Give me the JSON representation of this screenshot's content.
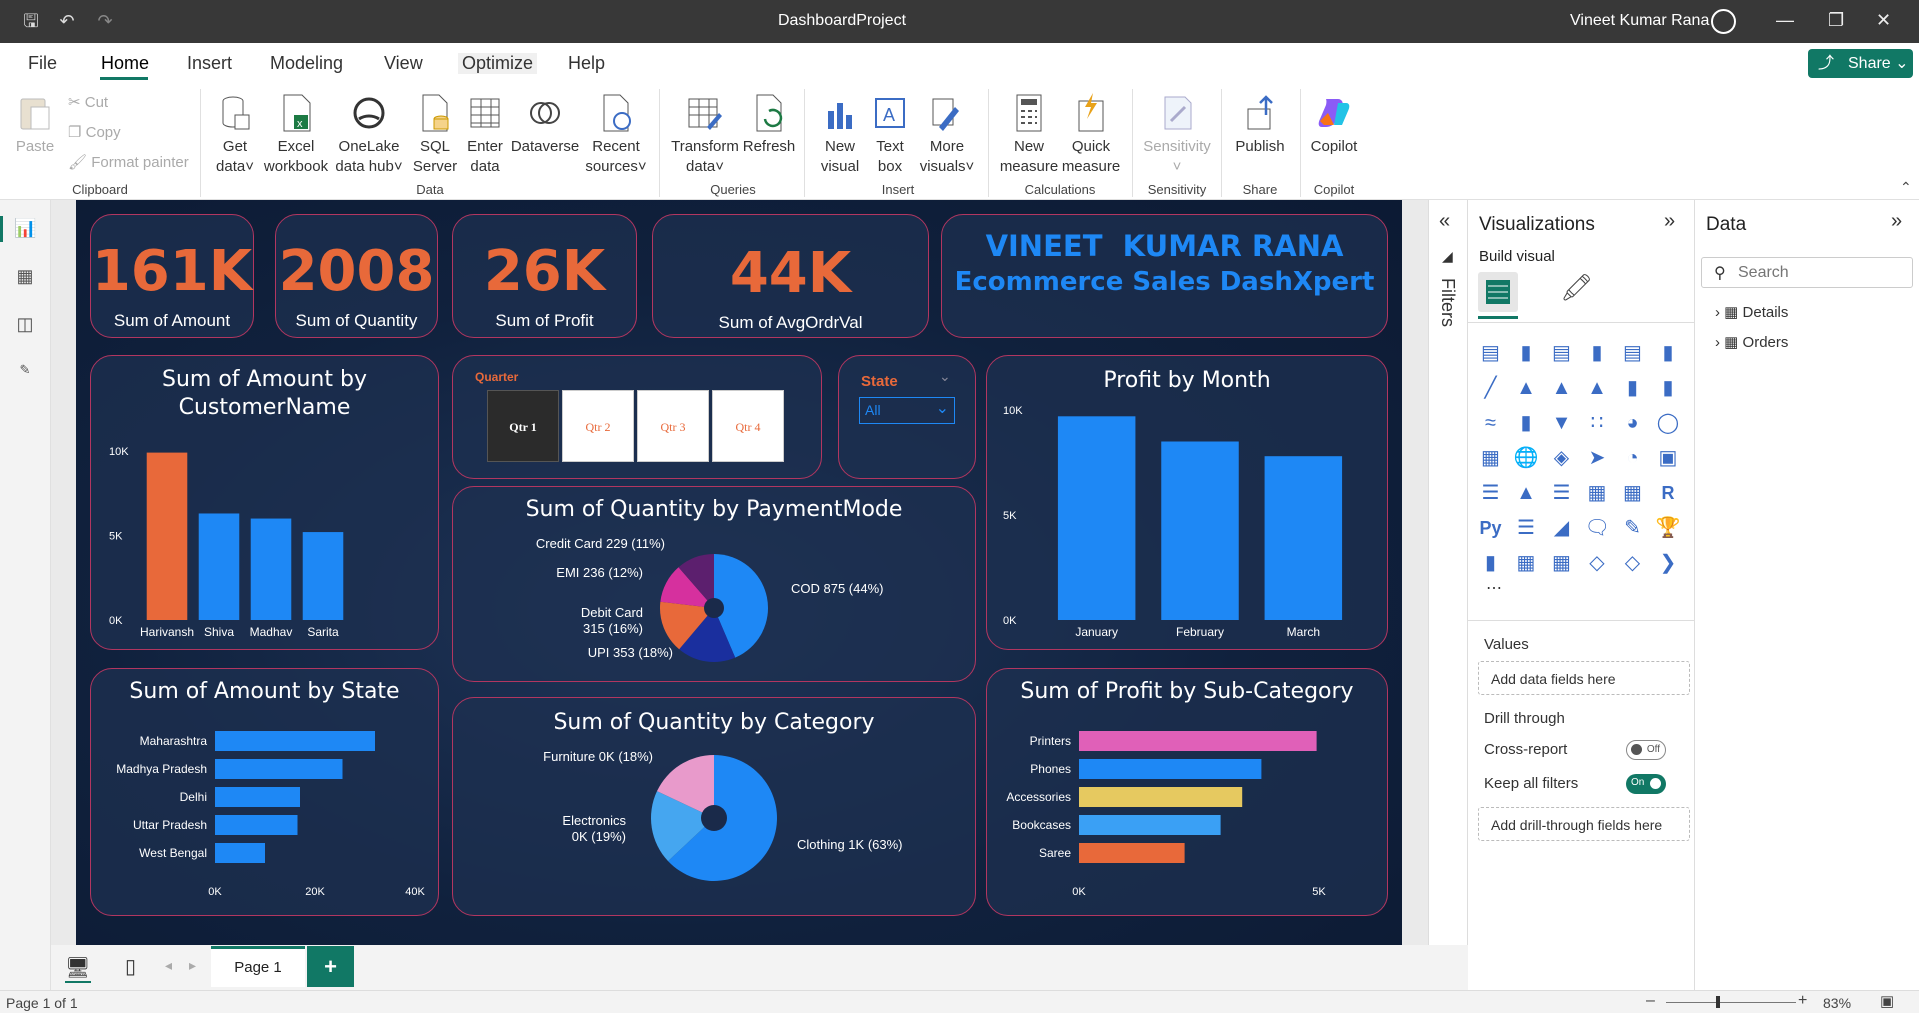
{
  "titlebar": {
    "document_title": "DashboardProject",
    "user_name": "Vineet Kumar Rana"
  },
  "menu": {
    "items": [
      "File",
      "Home",
      "Insert",
      "Modeling",
      "View",
      "Optimize",
      "Help"
    ],
    "share_label": "Share"
  },
  "ribbon": {
    "clipboard": {
      "paste": "Paste",
      "cut": "Cut",
      "copy": "Copy",
      "format_painter": "Format painter",
      "group": "Clipboard"
    },
    "data": {
      "get_data_1": "Get",
      "get_data_2": "data",
      "excel_1": "Excel",
      "excel_2": "workbook",
      "onelake_1": "OneLake",
      "onelake_2": "data hub",
      "sql_1": "SQL",
      "sql_2": "Server",
      "enter_1": "Enter",
      "enter_2": "data",
      "dataverse": "Dataverse",
      "recent_1": "Recent",
      "recent_2": "sources",
      "group": "Data"
    },
    "queries": {
      "transform_1": "Transform",
      "transform_2": "data",
      "refresh": "Refresh",
      "group": "Queries"
    },
    "insert": {
      "new_visual_1": "New",
      "new_visual_2": "visual",
      "text_box_1": "Text",
      "text_box_2": "box",
      "more_visuals_1": "More",
      "more_visuals_2": "visuals",
      "group": "Insert"
    },
    "calculations": {
      "new_measure_1": "New",
      "new_measure_2": "measure",
      "quick_measure_1": "Quick",
      "quick_measure_2": "measure",
      "group": "Calculations"
    },
    "sensitivity": {
      "label": "Sensitivity",
      "group": "Sensitivity"
    },
    "share": {
      "publish": "Publish",
      "group": "Share"
    },
    "copilot": {
      "label": "Copilot",
      "group": "Copilot"
    }
  },
  "report": {
    "kpis": [
      {
        "value": "161K",
        "label": "Sum of Amount"
      },
      {
        "value": "2008",
        "label": "Sum of Quantity"
      },
      {
        "value": "26K",
        "label": "Sum of Profit"
      },
      {
        "value": "44K",
        "label": "Sum of AvgOrdrVal"
      }
    ],
    "banner": {
      "line1": "VINEET  KUMAR RANA",
      "line2": "Ecommerce Sales DashXpert"
    },
    "quarter_slicer": {
      "title": "Quarter",
      "options": [
        "Qtr 1",
        "Qtr 2",
        "Qtr 3",
        "Qtr 4"
      ],
      "selected": "Qtr 1"
    },
    "state_slicer": {
      "title": "State",
      "value": "All"
    }
  },
  "chart_data": [
    {
      "id": "amount-by-customer",
      "type": "bar",
      "title": "Sum of Amount by CustomerName",
      "categories": [
        "Harivansh",
        "Shiva",
        "Madhav",
        "Sarita"
      ],
      "values": [
        9900,
        6300,
        6000,
        5200
      ],
      "ylim": [
        0,
        11000
      ],
      "yticks": [
        "10K",
        "5K",
        "0K"
      ],
      "colors": [
        "#e8693a",
        "#1e88f5",
        "#1e88f5",
        "#1e88f5"
      ]
    },
    {
      "id": "quantity-by-paymentmode",
      "type": "pie",
      "title": "Sum of Quantity by PaymentMode",
      "slices": [
        {
          "label": "COD 875 (44%)",
          "value": 875,
          "color": "#1e88f5"
        },
        {
          "label": "UPI 353 (18%)",
          "value": 353,
          "color": "#1a2f9e"
        },
        {
          "label": "Debit Card 315 (16%)",
          "value": 315,
          "color": "#e8693a"
        },
        {
          "label": "EMI 236 (12%)",
          "value": 236,
          "color": "#d6309e"
        },
        {
          "label": "Credit Card 229 (11%)",
          "value": 229,
          "color": "#5c1f6e"
        }
      ]
    },
    {
      "id": "profit-by-month",
      "type": "bar",
      "title": "Profit by Month",
      "categories": [
        "January",
        "February",
        "March"
      ],
      "values": [
        9700,
        8500,
        7800
      ],
      "ylim": [
        0,
        10000
      ],
      "yticks": [
        "10K",
        "5K",
        "0K"
      ],
      "colors": [
        "#1e88f5",
        "#1e88f5",
        "#1e88f5"
      ]
    },
    {
      "id": "amount-by-state",
      "type": "bar",
      "title": "Sum of Amount by State",
      "orientation": "horizontal",
      "categories": [
        "Maharashtra",
        "Madhya Pradesh",
        "Delhi",
        "Uttar Pradesh",
        "West Bengal"
      ],
      "values": [
        32000,
        25500,
        17000,
        16500,
        10000
      ],
      "xlim": [
        0,
        40000
      ],
      "xticks": [
        "0K",
        "20K",
        "40K"
      ],
      "colors": [
        "#1e88f5",
        "#1e88f5",
        "#1e88f5",
        "#1e88f5",
        "#1e88f5"
      ]
    },
    {
      "id": "quantity-by-category",
      "type": "pie",
      "title": "Sum of Quantity by Category",
      "donut": true,
      "slices": [
        {
          "label": "Clothing 1K (63%)",
          "value": 63,
          "color": "#1e88f5"
        },
        {
          "label": "Electronics 0K (19%)",
          "value": 19,
          "color": "#45a6f0"
        },
        {
          "label": "Furniture 0K (18%)",
          "value": 18,
          "color": "#e89acb"
        }
      ]
    },
    {
      "id": "profit-by-subcategory",
      "type": "bar",
      "title": "Sum of Profit by Sub-Category",
      "orientation": "horizontal",
      "categories": [
        "Printers",
        "Phones",
        "Accessories",
        "Bookcases",
        "Saree"
      ],
      "values": [
        4950,
        3800,
        3400,
        2950,
        2200
      ],
      "xlim": [
        0,
        5000
      ],
      "xticks": [
        "0K",
        "5K"
      ],
      "colors": [
        "#e060b8",
        "#1e88f5",
        "#e6c960",
        "#3aa0f5",
        "#e8693a"
      ]
    }
  ],
  "filters_pane": {
    "label": "Filters"
  },
  "visualizations": {
    "title": "Visualizations",
    "build_visual": "Build visual",
    "values_label": "Values",
    "values_placeholder": "Add data fields here",
    "drill_through": "Drill through",
    "cross_report": "Cross-report",
    "cross_report_state": "Off",
    "keep_filters": "Keep all filters",
    "keep_filters_state": "On",
    "drill_placeholder": "Add drill-through fields here"
  },
  "data_pane": {
    "title": "Data",
    "search_placeholder": "Search",
    "tables": [
      "Details",
      "Orders"
    ]
  },
  "pages": {
    "current": "Page 1"
  },
  "status": {
    "page_info": "Page 1 of 1",
    "zoom": "83%"
  }
}
